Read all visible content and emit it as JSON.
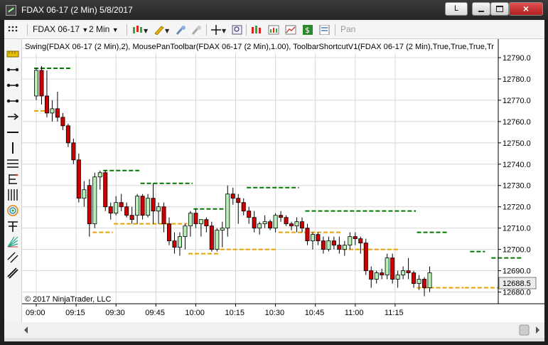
{
  "window": {
    "title": "FDAX 06-17 (2 Min)  5/8/2017",
    "btn_l": "L"
  },
  "toolbar": {
    "instrument": "FDAX 06-17",
    "interval": "2 Min",
    "pan": "Pan"
  },
  "chart": {
    "indicator_label": "Swing(FDAX 06-17 (2 Min),2), MousePanToolbar(FDAX 06-17 (2 Min),1.00), ToolbarShortcutV1(FDAX 06-17 (2 Min),True,True,True,Tr",
    "copyright": "© 2017 NinjaTrader, LLC",
    "last_price_badge": "12688.5",
    "colors": {
      "up": "#b7f0b7",
      "down": "#cc0000",
      "swing_high": "#007700",
      "swing_low": "#e6a100",
      "grid": "#d8d8d8"
    }
  },
  "chart_data": {
    "type": "candlestick",
    "y_ticks": [
      "12790.0",
      "12780.0",
      "12770.0",
      "12760.0",
      "12750.0",
      "12740.0",
      "12730.0",
      "12720.0",
      "12710.0",
      "12700.0",
      "12690.0",
      "12680.0"
    ],
    "x_ticks": [
      "09:00",
      "09:15",
      "09:30",
      "09:45",
      "10:00",
      "10:15",
      "10:30",
      "10:45",
      "11:00",
      "11:15"
    ],
    "ylim": [
      12674,
      12792
    ],
    "candles": [
      [
        12772,
        12785,
        12770,
        12784
      ],
      [
        12784,
        12786,
        12768,
        12772
      ],
      [
        12772,
        12784,
        12762,
        12764
      ],
      [
        12764,
        12770,
        12760,
        12766
      ],
      [
        12766,
        12774,
        12760,
        12762
      ],
      [
        12762,
        12764,
        12756,
        12758
      ],
      [
        12758,
        12759,
        12748,
        12750
      ],
      [
        12750,
        12752,
        12740,
        12742
      ],
      [
        12742,
        12745,
        12722,
        12724
      ],
      [
        12724,
        12732,
        12720,
        12728
      ],
      [
        12730,
        12733,
        12706,
        12712
      ],
      [
        12712,
        12736,
        12710,
        12734
      ],
      [
        12734,
        12737,
        12728,
        12736
      ],
      [
        12736,
        12737,
        12718,
        12720
      ],
      [
        12720,
        12722,
        12714,
        12717
      ],
      [
        12717,
        12725,
        12716,
        12722
      ],
      [
        12722,
        12726,
        12718,
        12720
      ],
      [
        12720,
        12722,
        12715,
        12716
      ],
      [
        12716,
        12720,
        12712,
        12714
      ],
      [
        12716,
        12726,
        12712,
        12725
      ],
      [
        12725,
        12726,
        12714,
        12716
      ],
      [
        12716,
        12726,
        12715,
        12724
      ],
      [
        12724,
        12731,
        12712,
        12718
      ],
      [
        12718,
        12722,
        12712,
        12720
      ],
      [
        12720,
        12722,
        12708,
        12712
      ],
      [
        12712,
        12715,
        12702,
        12704
      ],
      [
        12704,
        12708,
        12698,
        12701
      ],
      [
        12701,
        12708,
        12697,
        12706
      ],
      [
        12706,
        12712,
        12700,
        12711
      ],
      [
        12711,
        12718,
        12706,
        12717
      ],
      [
        12717,
        12719,
        12710,
        12712
      ],
      [
        12712,
        12714,
        12706,
        12714
      ],
      [
        12714,
        12715,
        12708,
        12711
      ],
      [
        12711,
        12713,
        12699,
        12700
      ],
      [
        12700,
        12710,
        12699,
        12709
      ],
      [
        12709,
        12713,
        12701,
        12710
      ],
      [
        12710,
        12730,
        12706,
        12726
      ],
      [
        12726,
        12729,
        12721,
        12724
      ],
      [
        12724,
        12726,
        12712,
        12722
      ],
      [
        12722,
        12724,
        12716,
        12718
      ],
      [
        12718,
        12720,
        12712,
        12715
      ],
      [
        12715,
        12718,
        12708,
        12710
      ],
      [
        12710,
        12713,
        12707,
        12712
      ],
      [
        12712,
        12716,
        12710,
        12713
      ],
      [
        12713,
        12714,
        12709,
        12710
      ],
      [
        12710,
        12717,
        12708,
        12716
      ],
      [
        12716,
        12718,
        12713,
        12715
      ],
      [
        12715,
        12716,
        12711,
        12712
      ],
      [
        12712,
        12713,
        12709,
        12711
      ],
      [
        12711,
        12715,
        12708,
        12713
      ],
      [
        12713,
        12715,
        12708,
        12710
      ],
      [
        12710,
        12712,
        12702,
        12704
      ],
      [
        12704,
        12708,
        12700,
        12707
      ],
      [
        12707,
        12708,
        12702,
        12704
      ],
      [
        12704,
        12706,
        12698,
        12700
      ],
      [
        12700,
        12706,
        12699,
        12704
      ],
      [
        12704,
        12706,
        12700,
        12702
      ],
      [
        12702,
        12706,
        12698,
        12700
      ],
      [
        12700,
        12704,
        12697,
        12702
      ],
      [
        12702,
        12708,
        12700,
        12706
      ],
      [
        12706,
        12708,
        12702,
        12705
      ],
      [
        12705,
        12706,
        12698,
        12703
      ],
      [
        12703,
        12705,
        12688,
        12690
      ],
      [
        12690,
        12692,
        12682,
        12686
      ],
      [
        12686,
        12690,
        12684,
        12689
      ],
      [
        12689,
        12691,
        12686,
        12688
      ],
      [
        12688,
        12698,
        12686,
        12696
      ],
      [
        12696,
        12698,
        12684,
        12686
      ],
      [
        12686,
        12690,
        12682,
        12688
      ],
      [
        12688,
        12692,
        12686,
        12690
      ],
      [
        12690,
        12696,
        12686,
        12689
      ],
      [
        12689,
        12690,
        12682,
        12684
      ],
      [
        12684,
        12688,
        12681,
        12686
      ],
      [
        12686,
        12687,
        12678,
        12682
      ],
      [
        12682,
        12692,
        12680,
        12689
      ]
    ],
    "swing_highs": [
      [
        0,
        6,
        12785
      ],
      [
        13,
        19,
        12737
      ],
      [
        20,
        29,
        12731
      ],
      [
        30,
        35,
        12719
      ],
      [
        40,
        49,
        12729
      ],
      [
        51,
        56,
        12718
      ],
      [
        57,
        71,
        12718
      ],
      [
        72,
        77,
        12708
      ],
      [
        82,
        84,
        12699
      ],
      [
        86,
        91,
        12696
      ]
    ],
    "swing_lows": [
      [
        0,
        2,
        12765
      ],
      [
        11,
        14,
        12708
      ],
      [
        15,
        28,
        12712
      ],
      [
        29,
        34,
        12698
      ],
      [
        35,
        45,
        12700
      ],
      [
        46,
        57,
        12708
      ],
      [
        58,
        68,
        12700
      ],
      [
        72,
        80,
        12682
      ],
      [
        81,
        89,
        12682
      ]
    ]
  }
}
